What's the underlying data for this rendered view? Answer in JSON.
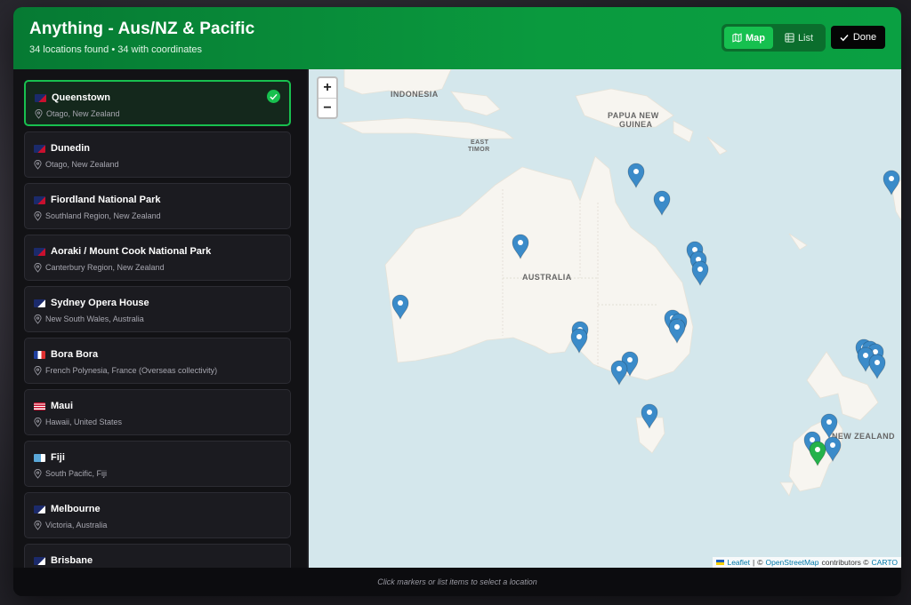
{
  "header": {
    "title": "Anything - Aus/NZ & Pacific",
    "summary": "34 locations found • 34 with coordinates"
  },
  "view_toggle": {
    "map_label": "Map",
    "list_label": "List",
    "active": "Map"
  },
  "done_label": "Done",
  "locations": [
    {
      "name": "Queenstown",
      "region": "Otago, New Zealand",
      "flag": "nz",
      "selected": true
    },
    {
      "name": "Dunedin",
      "region": "Otago, New Zealand",
      "flag": "nz"
    },
    {
      "name": "Fiordland National Park",
      "region": "Southland Region, New Zealand",
      "flag": "nz"
    },
    {
      "name": "Aoraki / Mount Cook National Park",
      "region": "Canterbury Region, New Zealand",
      "flag": "nz"
    },
    {
      "name": "Sydney Opera House",
      "region": "New South Wales, Australia",
      "flag": "au"
    },
    {
      "name": "Bora Bora",
      "region": "French Polynesia, France (Overseas collectivity)",
      "flag": "fr"
    },
    {
      "name": "Maui",
      "region": "Hawaii, United States",
      "flag": "us"
    },
    {
      "name": "Fiji",
      "region": "South Pacific, Fiji",
      "flag": "fj"
    },
    {
      "name": "Melbourne",
      "region": "Victoria, Australia",
      "flag": "au"
    },
    {
      "name": "Brisbane",
      "region": "",
      "flag": "au"
    }
  ],
  "map": {
    "labels": {
      "indonesia": "INDONESIA",
      "png_line1": "PAPUA NEW",
      "png_line2": "GUINEA",
      "timor_line1": "EAST",
      "timor_line2": "TIMOR",
      "australia": "AUSTRALIA",
      "new_zealand": "NEW ZEALAND"
    },
    "zoom_in": "+",
    "zoom_out": "−",
    "attribution": {
      "leaflet": "Leaflet",
      "sep1": "|",
      "copy1": "©",
      "osm": "OpenStreetMap",
      "contributors": "contributors ©",
      "carto": "CARTO"
    },
    "colors": {
      "water": "#d4e7ec",
      "land": "#f7f5f0",
      "marker": "#3b8bc9",
      "selected_marker": "#24b24a"
    }
  },
  "footer_hint": "Click markers or list items to select a location"
}
